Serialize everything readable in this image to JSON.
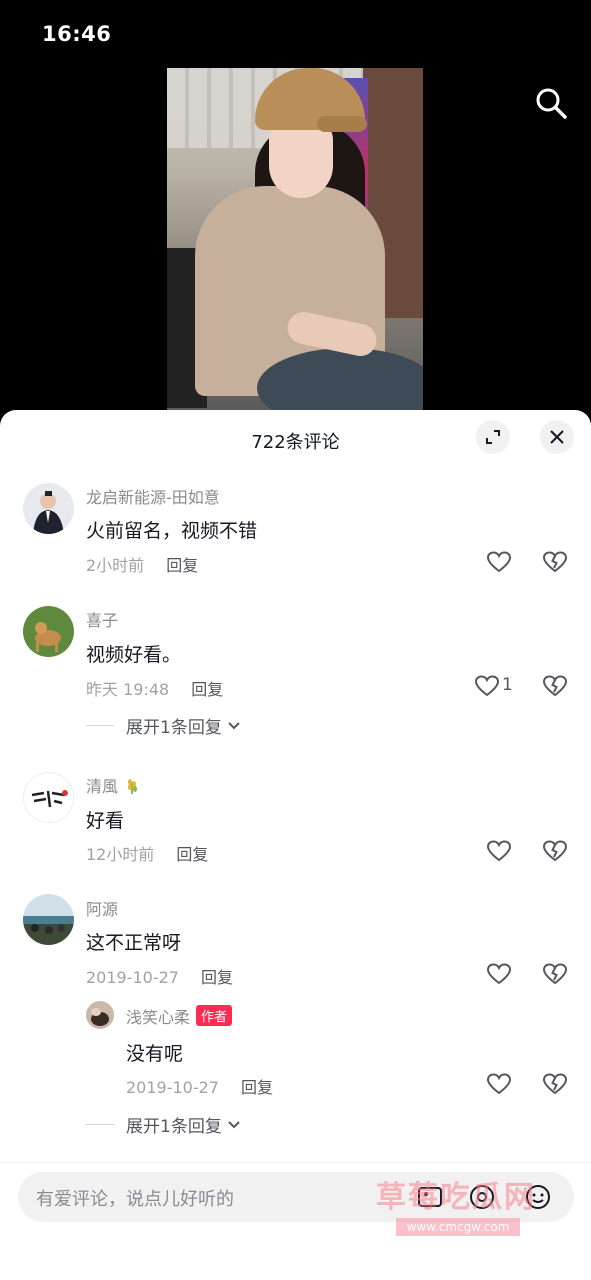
{
  "status_bar": {
    "time": "16:46"
  },
  "sheet": {
    "title": "722条评论"
  },
  "comments": [
    {
      "username": "龙启新能源-田如意",
      "text": "火前留名，视频不错",
      "time": "2小时前",
      "reply_label": "回复"
    },
    {
      "username": "喜子",
      "text": "视频好看。",
      "time": "昨天 19:48",
      "reply_label": "回复",
      "like_count": "1",
      "expand_label": "展开1条回复"
    },
    {
      "username": "清風",
      "text": "好看",
      "time": "12小时前",
      "reply_label": "回复"
    },
    {
      "username": "阿源",
      "text": "这不正常呀",
      "time": "2019-10-27",
      "reply_label": "回复"
    }
  ],
  "reply": {
    "username": "浅笑心柔",
    "badge": "作者",
    "text": "没有呢",
    "time": "2019-10-27",
    "reply_label": "回复",
    "expand_label": "展开1条回复"
  },
  "input": {
    "placeholder": "有爱评论，说点儿好听的"
  },
  "watermark": {
    "text": "草莓吃瓜网",
    "url": "www.cmcgw.com"
  },
  "colors": {
    "accent": "#fe2c55",
    "text": "#161823",
    "muted": "#8a8b91"
  }
}
